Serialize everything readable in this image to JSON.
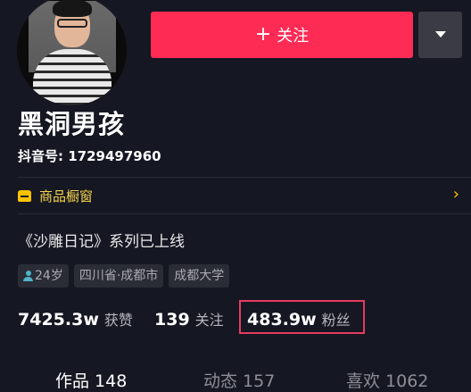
{
  "header": {
    "follow_label": "关注",
    "follow_icon": "+",
    "more_icon": "chevron-down-icon"
  },
  "profile": {
    "name": "黑洞男孩",
    "douyin_id": "抖音号: 1729497960"
  },
  "shop": {
    "label": "商品橱窗",
    "arrow": "›",
    "accent": "#ffc300"
  },
  "bio": "《沙雕日记》系列已上线",
  "tags": {
    "age": "24岁",
    "location": "四川省·成都市",
    "school": "成都大学"
  },
  "stats": {
    "likes": {
      "value": "7425.3w",
      "label": "获赞"
    },
    "following": {
      "value": "139",
      "label": "关注"
    },
    "followers": {
      "value": "483.9w",
      "label": "粉丝"
    }
  },
  "tabs": [
    {
      "label": "作品 148"
    },
    {
      "label": "动态 157"
    },
    {
      "label": "喜欢 1062"
    }
  ],
  "colors": {
    "background": "#151722",
    "follow_button": "#fe2c55",
    "highlight": "#e53c5f"
  }
}
